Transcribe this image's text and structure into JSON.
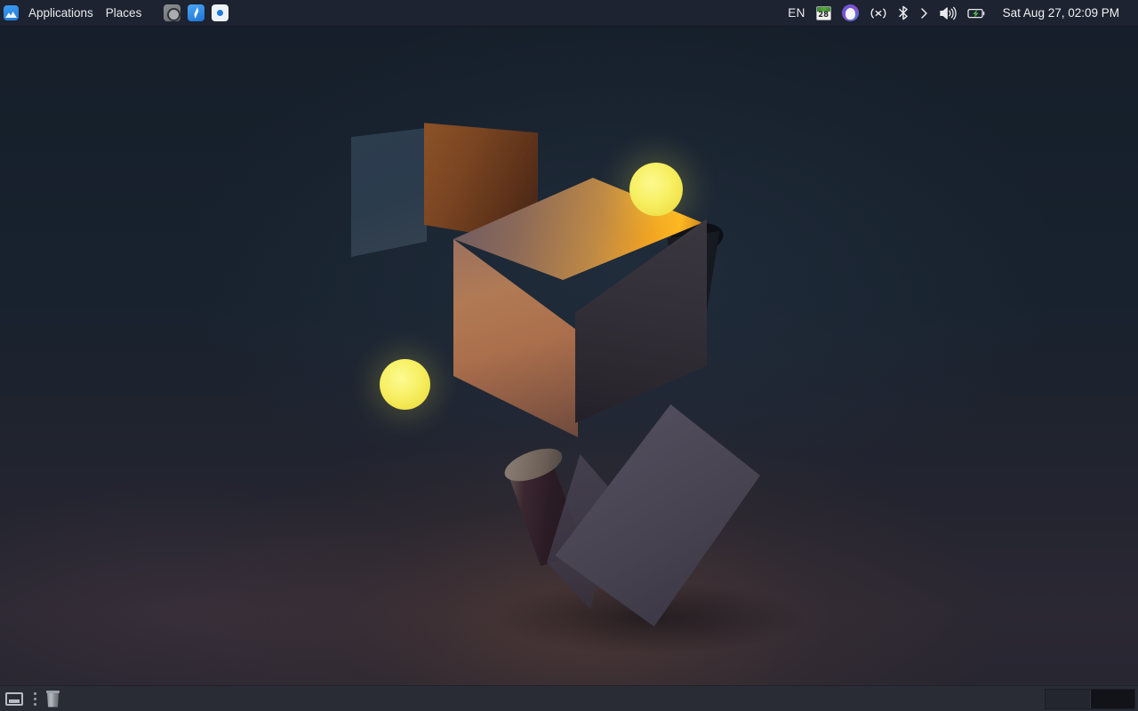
{
  "desktop": {
    "wallpaper_name": "abstract-3d-cubes-spheres-dark",
    "background_colors": {
      "top": "#151e29",
      "mid": "#23242f",
      "bottom": "#262530",
      "accent_orange": "#ffb61f",
      "accent_yellow": "#f7ef62",
      "cube_blue_face": "#2c3d4f"
    }
  },
  "top_panel": {
    "background": "#1d2330",
    "launcher_icon": "app-launcher-icon",
    "menus": [
      {
        "label": "Applications",
        "name": "menu-applications"
      },
      {
        "label": "Places",
        "name": "menu-places"
      }
    ],
    "quick_launch": [
      {
        "name": "tray-app-camera",
        "icon": "camera-icon"
      },
      {
        "name": "tray-app-browser",
        "icon": "compass-browser-icon"
      },
      {
        "name": "tray-app-dot",
        "icon": "blue-dot-icon"
      }
    ],
    "tray": {
      "keyboard_language": "EN",
      "calendar_day": "28",
      "calendar_icon": "calendar-icon",
      "avatar_icon": "user-avatar-icon",
      "vpn_icon": "vpn-network-icon",
      "bluetooth_icon": "bluetooth-icon",
      "chevron_icon": "chevron-right-icon",
      "volume_icon": "volume-speaker-icon",
      "battery_icon": "battery-charging-icon"
    },
    "clock": "Sat Aug 27, 02:09 PM"
  },
  "bottom_panel": {
    "background": "#2a2c35",
    "show_desktop_icon": "show-desktop-icon",
    "grip_handle": "panel-grip-handle",
    "trash_icon": "trash-icon",
    "window_buttons": [],
    "workspaces": [
      {
        "name": "workspace-1",
        "active": true
      },
      {
        "name": "workspace-2",
        "active": false
      }
    ]
  }
}
